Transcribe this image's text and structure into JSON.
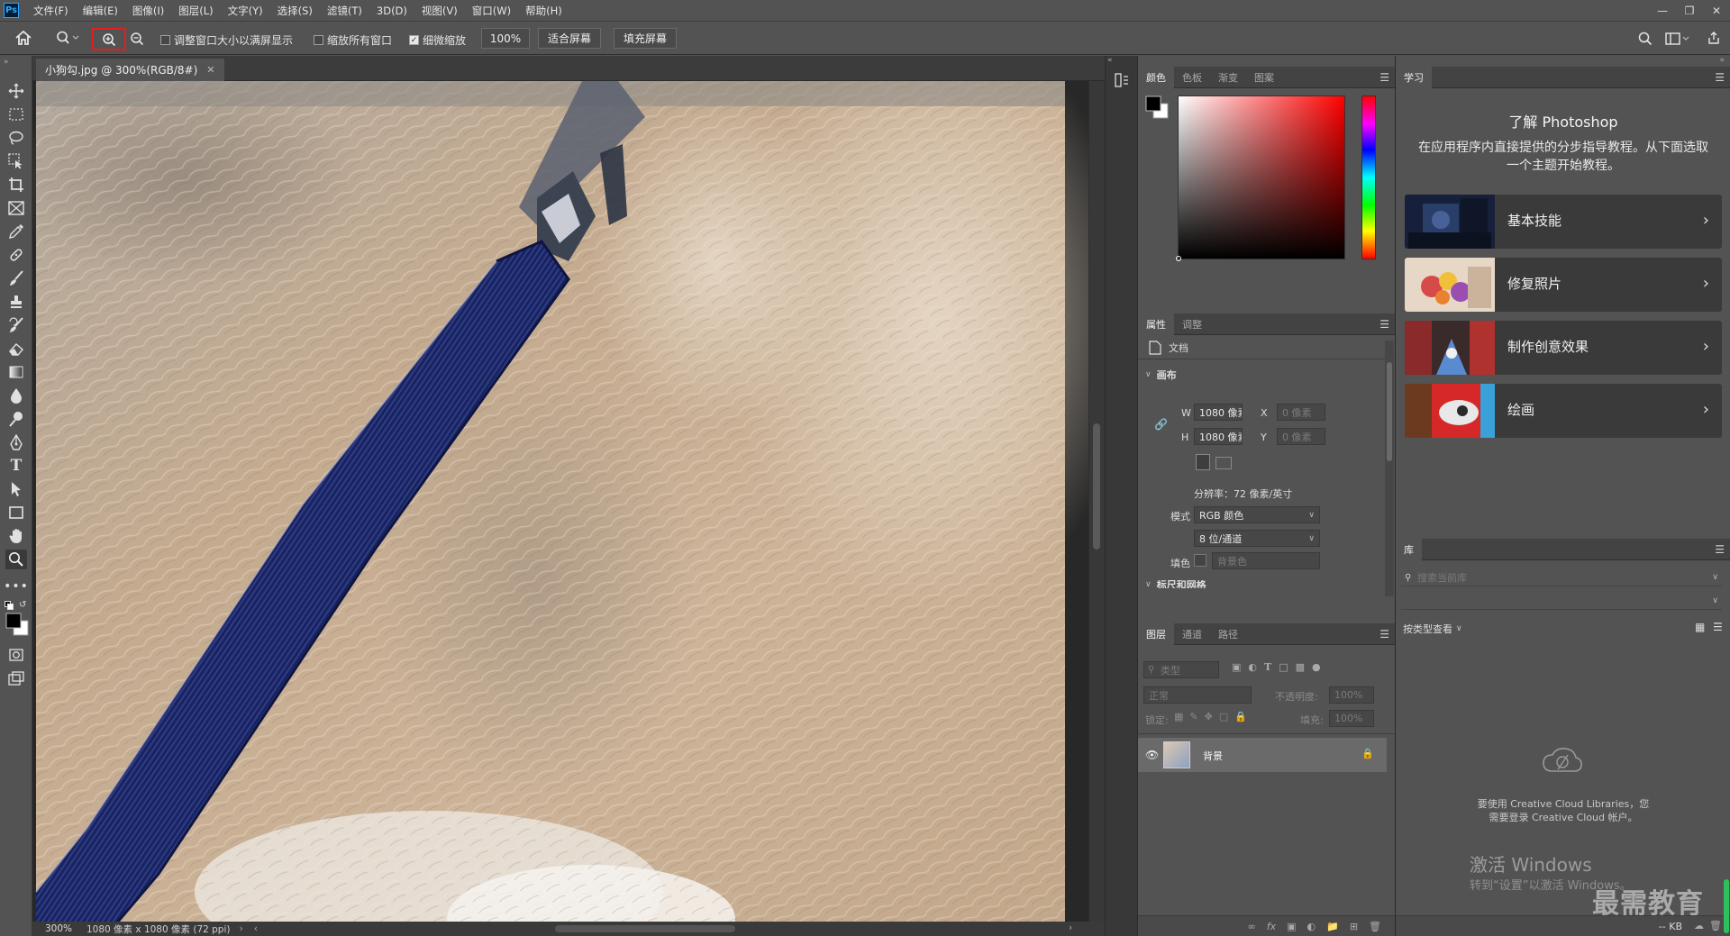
{
  "app": {
    "logo": "Ps"
  },
  "menu": [
    "文件(F)",
    "编辑(E)",
    "图像(I)",
    "图层(L)",
    "文字(Y)",
    "选择(S)",
    "滤镜(T)",
    "3D(D)",
    "视图(V)",
    "窗口(W)",
    "帮助(H)"
  ],
  "options": {
    "resize_windows": {
      "label": "调整窗口大小以满屏显示",
      "checked": false
    },
    "zoom_all": {
      "label": "缩放所有窗口",
      "checked": false
    },
    "scrubby": {
      "label": "细微缩放",
      "checked": true
    },
    "zoom_value": "100%",
    "fit_screen": "适合屏幕",
    "fill_screen": "填充屏幕"
  },
  "document": {
    "tab_title": "小狗勾.jpg @ 300%(RGB/8#)",
    "zoom": "300%",
    "info": "1080 像素 x 1080 像素 (72 ppi)"
  },
  "color_panel": {
    "tabs": [
      "颜色",
      "色板",
      "渐变",
      "图案"
    ]
  },
  "properties_panel": {
    "tabs": [
      "属性",
      "调整"
    ],
    "doc_label": "文档",
    "canvas_section": "画布",
    "w_label": "W",
    "w_value": "1080 像素",
    "h_label": "H",
    "h_value": "1080 像素",
    "x_label": "X",
    "x_value": "0 像素",
    "y_label": "Y",
    "y_value": "0 像素",
    "resolution": "分辨率：72 像素/英寸",
    "mode_label": "模式",
    "mode_value": "RGB 颜色",
    "depth_value": "8 位/通道",
    "fill_label": "填色",
    "fill_value": "背景色",
    "rulers_section": "标尺和网格"
  },
  "layers_panel": {
    "tabs": [
      "图层",
      "通道",
      "路径"
    ],
    "filter_kind": "类型",
    "blend_mode": "正常",
    "opacity_label": "不透明度:",
    "opacity_value": "100%",
    "lock_label": "锁定:",
    "fill_label": "填充:",
    "fill_value": "100%",
    "layer_name": "背景"
  },
  "learn_panel": {
    "tab": "学习",
    "title": "了解 Photoshop",
    "description": "在应用程序内直接提供的分步指导教程。从下面选取一个主题开始教程。",
    "cards": [
      "基本技能",
      "修复照片",
      "制作创意效果",
      "绘画"
    ]
  },
  "library_panel": {
    "tab": "库",
    "search_placeholder": "搜索当前库",
    "view_label": "按类型查看",
    "cc_message_1": "要使用 Creative Cloud Libraries，您",
    "cc_message_2": "需要登录 Creative Cloud 帐户。",
    "size": "-- KB"
  },
  "watermarks": {
    "activate_title": "激活 Windows",
    "activate_sub": "转到“设置”以激活 Windows。",
    "brand": "最需教育"
  },
  "colors": {
    "accent_red": "#e02020",
    "leash_blue": "#1e2a6e",
    "fur": "#cbb195"
  }
}
